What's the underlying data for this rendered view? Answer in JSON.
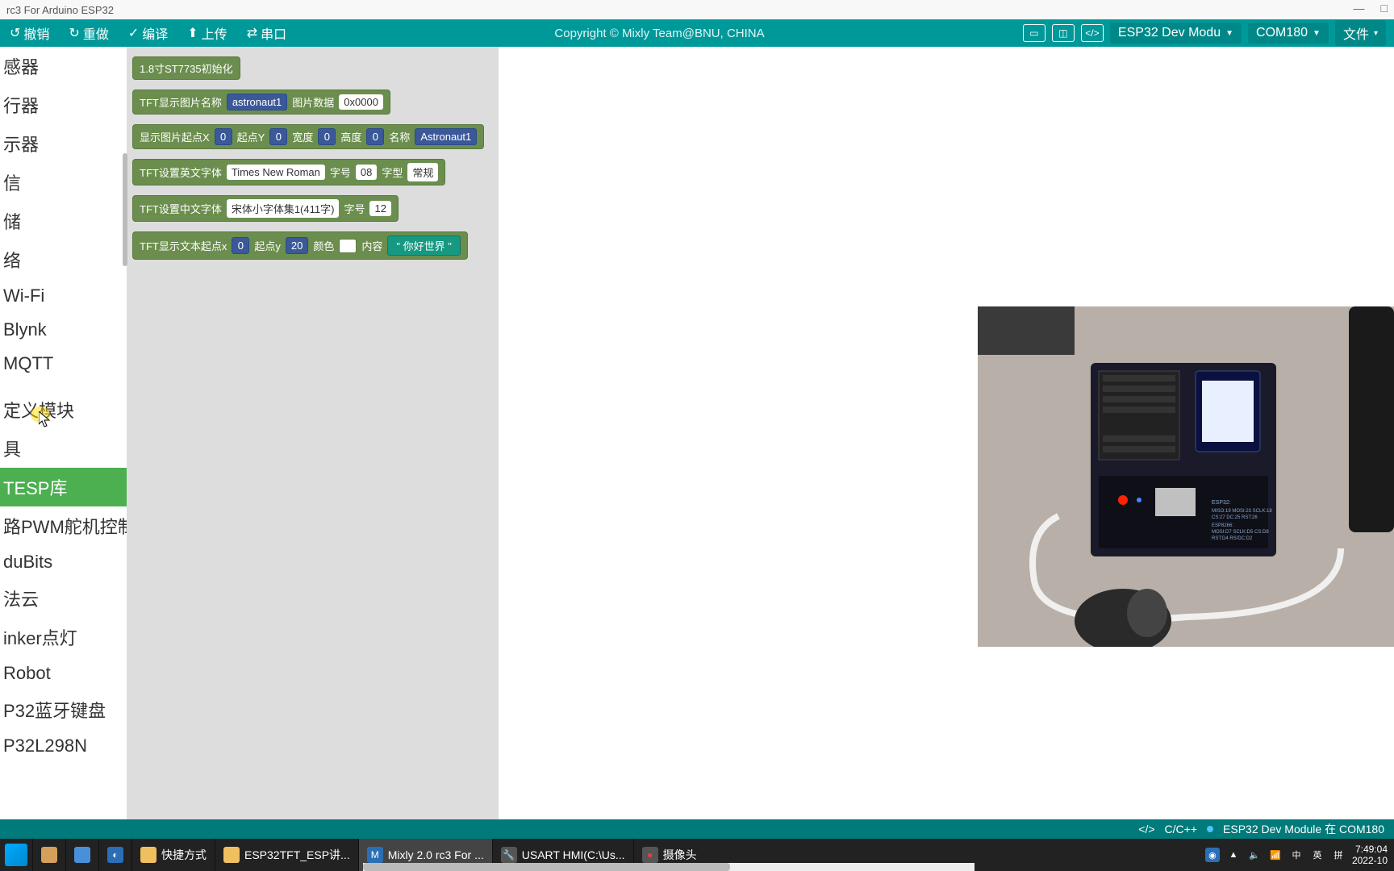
{
  "window": {
    "title": "rc3 For Arduino ESP32"
  },
  "toolbar": {
    "undo": "撤销",
    "redo": "重做",
    "compile": "编译",
    "upload": "上传",
    "serial": "串口",
    "copyright": "Copyright © Mixly Team@BNU, CHINA",
    "board": "ESP32 Dev Modu",
    "port": "COM180",
    "file": "文件"
  },
  "sidebar": {
    "items": [
      "感器",
      "行器",
      "示器",
      "信",
      "储",
      "络",
      "Wi-Fi",
      "Blynk",
      "MQTT"
    ],
    "items2": [
      "定义模块",
      "具",
      "TESP库",
      "路PWM舵机控制板",
      "duBits",
      "法云",
      "inker点灯",
      "Robot",
      "P32蓝牙键盘",
      "P32L298N"
    ],
    "activeIndex": 2
  },
  "blocks": {
    "b1": {
      "label": "1.8寸ST7735初始化"
    },
    "b2": {
      "a": "TFT显示图片名称",
      "v1": "astronaut1",
      "b": "图片数据",
      "v2": "0x0000"
    },
    "b3": {
      "a": "显示图片起点X",
      "v1": "0",
      "b": "起点Y",
      "v2": "0",
      "c": "宽度",
      "v3": "0",
      "d": "高度",
      "v4": "0",
      "e": "名称",
      "v5": "Astronaut1"
    },
    "b4": {
      "a": "TFT设置英文字体",
      "v1": "Times New Roman",
      "b": "字号",
      "v2": "08",
      "c": "字型",
      "v3": "常规"
    },
    "b5": {
      "a": "TFT设置中文字体",
      "v1": "宋体小字体集1(411字)",
      "b": "字号",
      "v2": "12"
    },
    "b6": {
      "a": "TFT显示文本起点x",
      "v1": "0",
      "b": "起点y",
      "v2": "20",
      "c": "颜色",
      "d": "内容",
      "v3": "你好世界"
    }
  },
  "status": {
    "lang": "C/C++",
    "board": "ESP32 Dev Module 在 COM180"
  },
  "taskbar": {
    "items": [
      {
        "label": "快捷方式"
      },
      {
        "label": "ESP32TFT_ESP讲..."
      },
      {
        "label": "Mixly 2.0 rc3 For ..."
      },
      {
        "label": "USART HMI(C:\\Us..."
      },
      {
        "label": "摄像头"
      }
    ],
    "tray": {
      "ime1": "中",
      "ime2": "英",
      "ime3": "拼"
    },
    "clock": {
      "time": "7:49:04",
      "date": "2022-10"
    }
  }
}
